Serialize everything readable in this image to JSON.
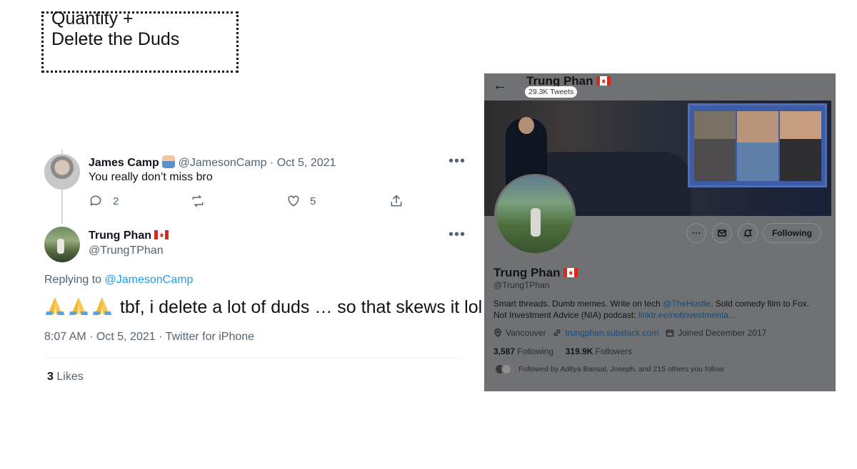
{
  "slide": {
    "title_line1": "Quantity +",
    "title_line2": "Delete the Duds"
  },
  "reply_tweet": {
    "name": "James Camp",
    "handle": "@JamesonCamp",
    "date": "· Oct 5, 2021",
    "text": "You really don’t miss bro",
    "reply_count": "2",
    "like_count": "5",
    "more": "•••"
  },
  "main_tweet": {
    "name": "Trung Phan",
    "handle": "@TrungTPhan",
    "more": "•••",
    "replying_prefix": "Replying to",
    "replying_to": "@JamesonCamp",
    "text": "tbf, i delete a lot of duds … so that skews it lol",
    "meta": "8:07 AM · Oct 5, 2021 · Twitter for iPhone",
    "likes_count": "3",
    "likes_label": "Likes"
  },
  "profile": {
    "title": "Trung Phan",
    "tweet_count": "29.3K Tweets",
    "following_button": "Following",
    "name": "Trung Phan",
    "handle": "@TrungTPhan",
    "bio_line1_prefix": "Smart threads. Dumb memes. Write on tech",
    "bio_mention": "@TheHustle",
    "bio_line1_suffix": ". Sold comedy film to Fox.",
    "bio_line2_prefix": "Not Investment Advice (NIA) podcast:",
    "bio_link": "linktr.ee/notinvestmenta...",
    "location": "Vancouver",
    "website": "trungphan.substack.com",
    "joined": "Joined December 2017",
    "following_count": "3,587",
    "following_label": "Following",
    "followers_count": "319.9K",
    "followers_label": "Followers",
    "followed_by": "Followed by Aditya Bansal, Joseph, and 215 others you follow"
  }
}
